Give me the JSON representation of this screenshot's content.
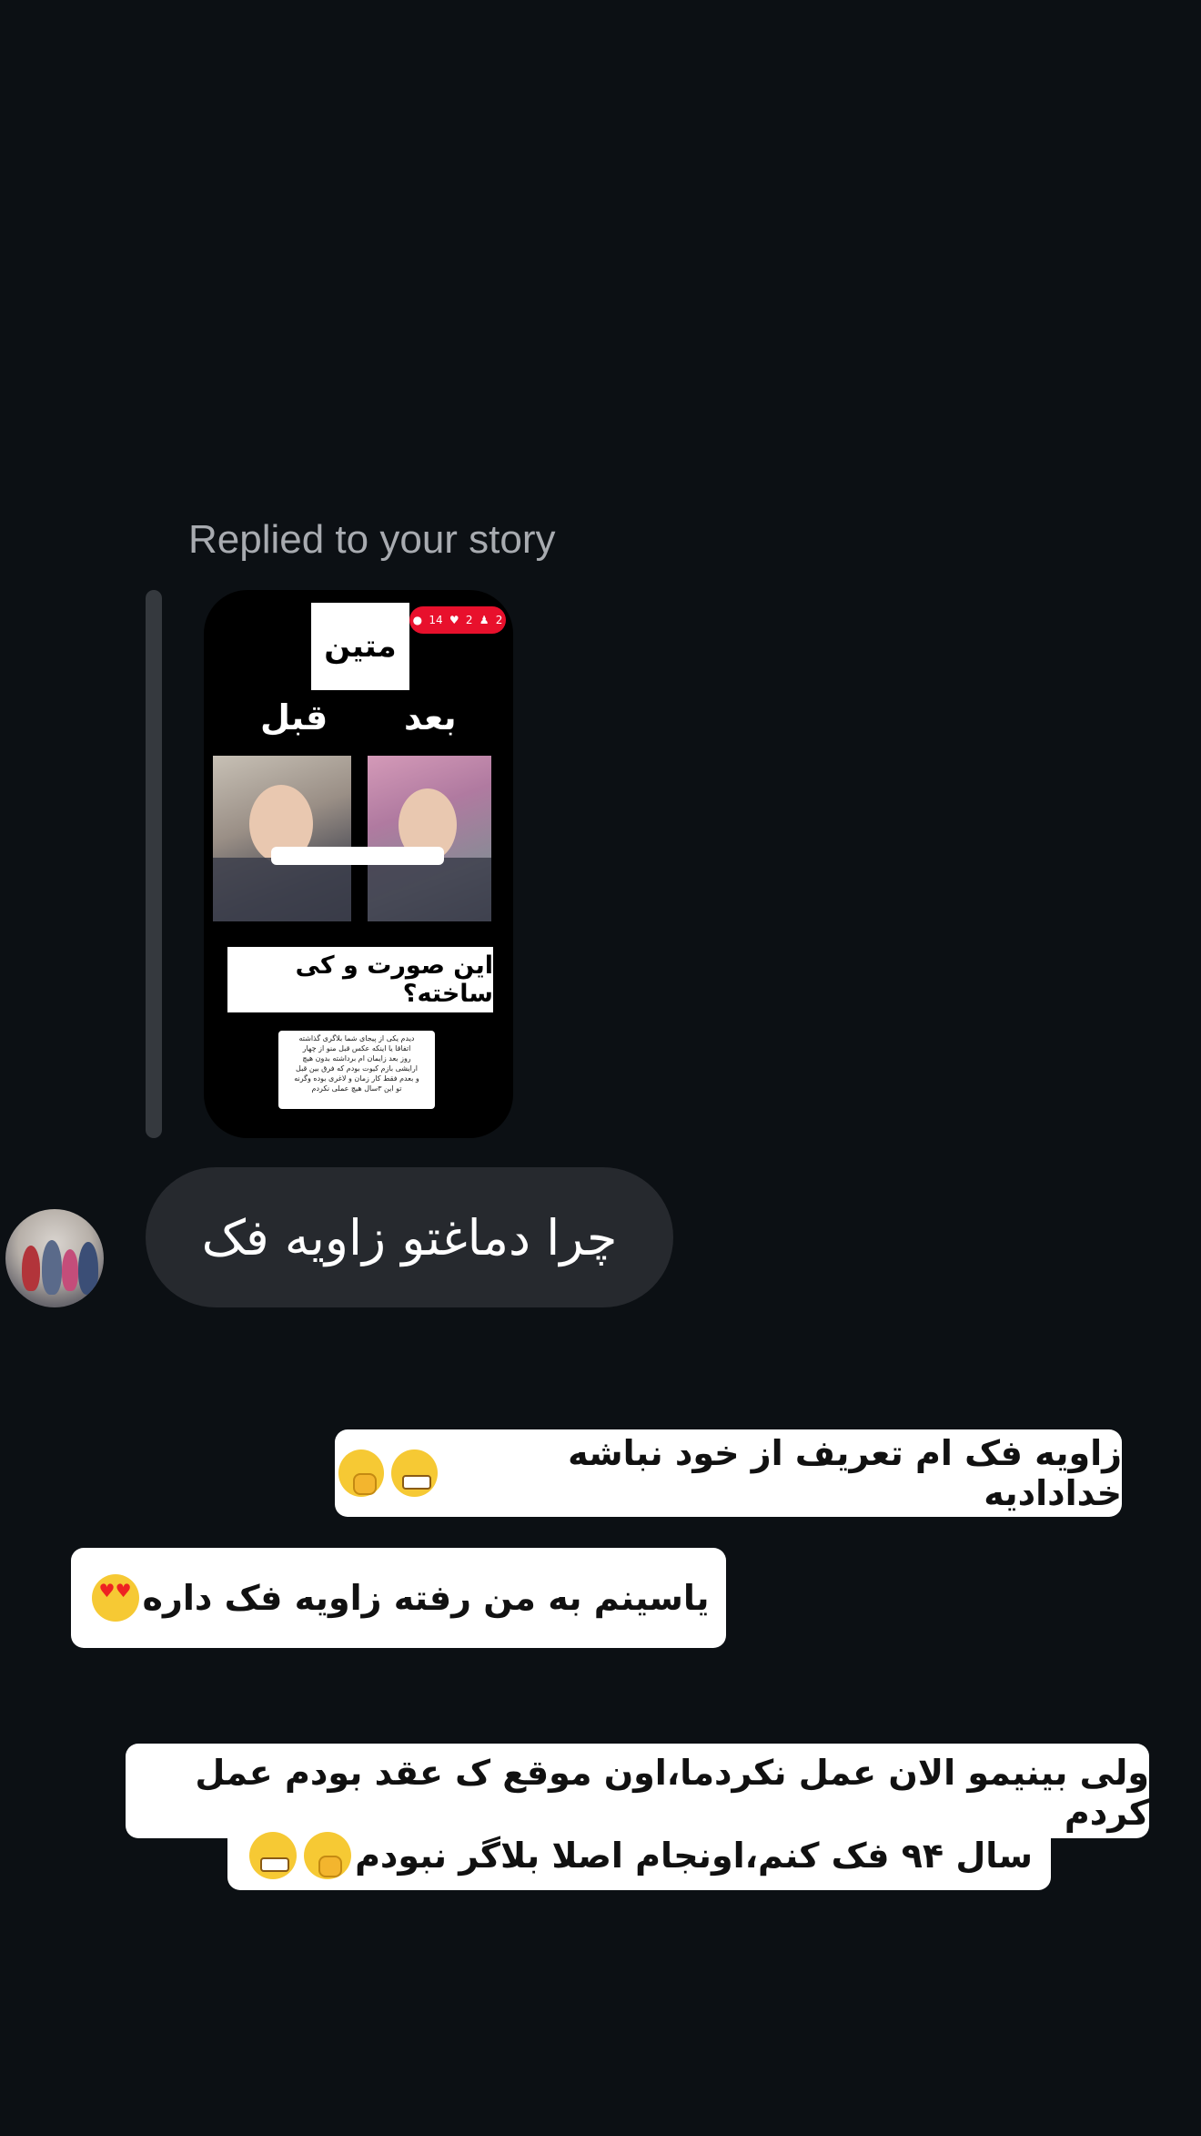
{
  "reply_header": {
    "label": "Replied to your story"
  },
  "story_preview": {
    "name": "متین",
    "after_label": "بعد",
    "before_label": "قبل",
    "stats": {
      "comments": "14",
      "likes": "2",
      "followers": "2"
    },
    "question": "این صورت و کی ساخته؟",
    "note_lines": [
      "دیدم یکی از پیجای شما بلاگری گذاشته",
      "اتفاقا یا اینکه عکس قبل منو از چهار",
      "روز بعد زایمان ام برداشته بدون هیچ",
      "ارایشی بازم کیوت بودم که فرق بین قبل",
      "و بعدم فقط کار زمان و لاغری بوده وگرنه",
      "تو این ۳سال هیچ عملی نکردم"
    ]
  },
  "received_message": {
    "text": "چرا دماغتو زاویه فک"
  },
  "sent_messages": [
    {
      "text": "زاویه فک ام تعریف از خود نباشه خدادادیه",
      "emojis": [
        "grimace-icon",
        "shushing-face-icon"
      ]
    },
    {
      "text": "یاسینم به من رفته زاویه فک داره",
      "emojis": [
        "heart-eyes-icon"
      ]
    },
    {
      "line1": "ولی بینیمو الان عمل نکردما،اون موقع ک عقد بودم عمل کردم",
      "line2": "سال ۹۴ فک کنم،اونجام اصلا بلاگر نبودم",
      "emojis": [
        "shushing-face-icon",
        "grimace-icon"
      ]
    }
  ],
  "colors": {
    "background": "#0c1014",
    "received_bubble": "#26292e",
    "stats_badge": "#e8102c"
  }
}
